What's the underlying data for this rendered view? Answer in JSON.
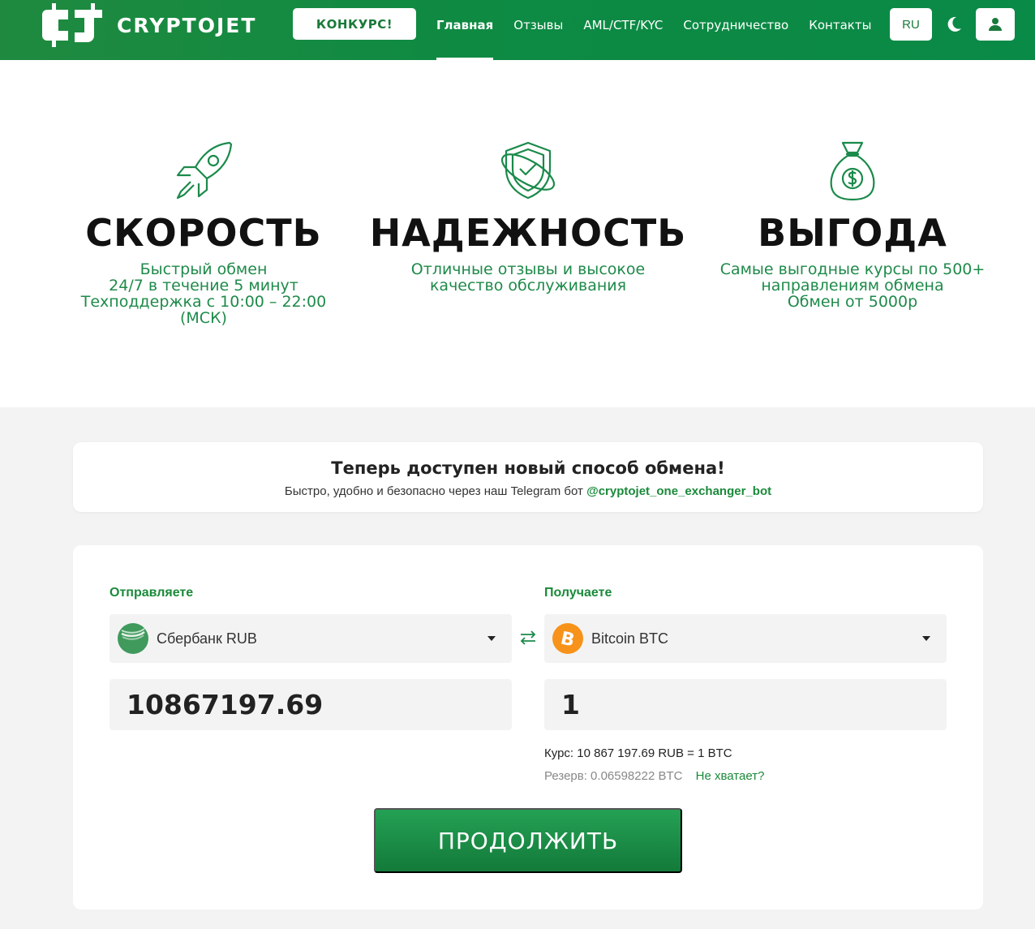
{
  "header": {
    "logo_text": "CRYPTOJET",
    "contest_label": "КОНКУРС!",
    "nav": [
      {
        "label": "Главная",
        "active": true
      },
      {
        "label": "Отзывы",
        "active": false
      },
      {
        "label": "AML/CTF/KYC",
        "active": false
      },
      {
        "label": "Сотрудничество",
        "active": false
      },
      {
        "label": "Контакты",
        "active": false
      }
    ],
    "lang": "RU",
    "theme_icon": "moon-icon",
    "user_icon": "user-icon"
  },
  "features": [
    {
      "icon": "rocket-icon",
      "title": "СКОРОСТЬ",
      "lines": [
        "Быстрый обмен",
        "24/7 в течение 5 минут",
        "Техподдержка с 10:00 – 22:00",
        "(МСК)"
      ]
    },
    {
      "icon": "shield-check-icon",
      "title": "НАДЕЖНОСТЬ",
      "lines": [
        "Отличные отзывы и высокое",
        "качество обслуживания"
      ]
    },
    {
      "icon": "money-bag-icon",
      "title": "ВЫГОДА",
      "lines": [
        "Самые выгодные курсы по 500+",
        "направлениям обмена",
        "Обмен от 5000р"
      ]
    }
  ],
  "banner": {
    "title": "Теперь доступен новый способ обмена!",
    "subtitle": "Быстро, удобно и безопасно через наш Telegram бот",
    "bot_link": "@cryptojet_one_exchanger_bot"
  },
  "exchange": {
    "send_label": "Отправляете",
    "receive_label": "Получаете",
    "send_currency": "Сбербанк RUB",
    "receive_currency": "Bitcoin BTC",
    "send_amount": "10867197.69",
    "receive_amount": "1",
    "rate": "Курс: 10 867 197.69 RUB = 1 BTC",
    "reserve": "Резерв: 0.06598222 BTC",
    "not_enough": "Не хватает?",
    "continue_label": "ПРОДОЛЖИТЬ"
  },
  "colors": {
    "brand_green": "#0d8a43",
    "accent_green": "#1f8a4a",
    "bitcoin_orange": "#f7931a",
    "sber_green": "#3f9a5c"
  }
}
